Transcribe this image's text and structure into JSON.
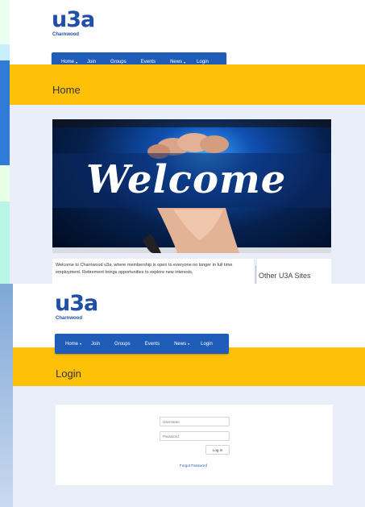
{
  "brand": {
    "logo": "u3a",
    "sub": "Charnwood"
  },
  "nav": {
    "items": [
      {
        "label": "Home",
        "caret": "▾"
      },
      {
        "label": "Join",
        "caret": ""
      },
      {
        "label": "Groups",
        "caret": ""
      },
      {
        "label": "Events",
        "caret": ""
      },
      {
        "label": "News",
        "caret": "▾"
      },
      {
        "label": "Login",
        "caret": ""
      }
    ]
  },
  "home_page": {
    "title": "Home",
    "banner_text": "Welcome",
    "intro": "Welcome to Charnwood u3a, where membership is open to everyone no longer in full time employment. Retirement brings opportunities to explore new interests,",
    "sidebar_heading": "Other U3A Sites"
  },
  "login_page": {
    "title": "Login",
    "username_placeholder": "Username",
    "password_placeholder": "Password",
    "login_button": "Log in",
    "forgot_link": "Forgot Password"
  },
  "colors": {
    "brand": "#1f4fa8",
    "nav": "#1f5cb8",
    "band": "#ffc107",
    "content": "#e9eef8"
  }
}
